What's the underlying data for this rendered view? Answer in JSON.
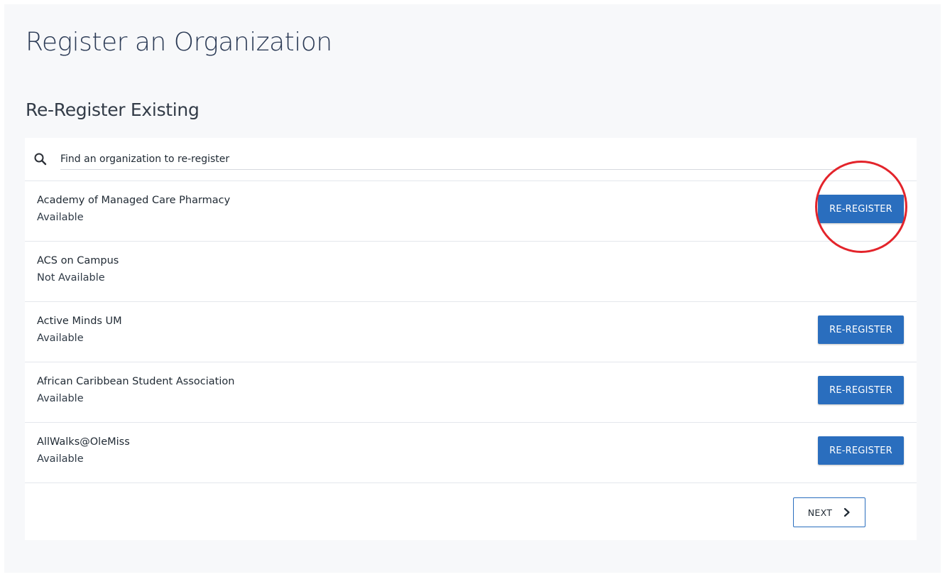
{
  "page": {
    "title": "Register an Organization",
    "section_title": "Re-Register Existing"
  },
  "search": {
    "placeholder": "Find an organization to re-register",
    "icon": "search-icon"
  },
  "organizations": [
    {
      "name": "Academy of Managed Care Pharmacy",
      "status": "Available",
      "action_label": "RE-REGISTER"
    },
    {
      "name": "ACS on Campus",
      "status": "Not Available"
    },
    {
      "name": "Active Minds UM",
      "status": "Available",
      "action_label": "RE-REGISTER"
    },
    {
      "name": "African Caribbean Student Association",
      "status": "Available",
      "action_label": "RE-REGISTER"
    },
    {
      "name": "AllWalks@OleMiss",
      "status": "Available",
      "action_label": "RE-REGISTER"
    }
  ],
  "pagination": {
    "next_label": "NEXT",
    "icon": "chevron-right-icon"
  },
  "colors": {
    "accent": "#2a6ebe",
    "annotation": "#e3242b",
    "page_background": "#f7f8fa"
  }
}
